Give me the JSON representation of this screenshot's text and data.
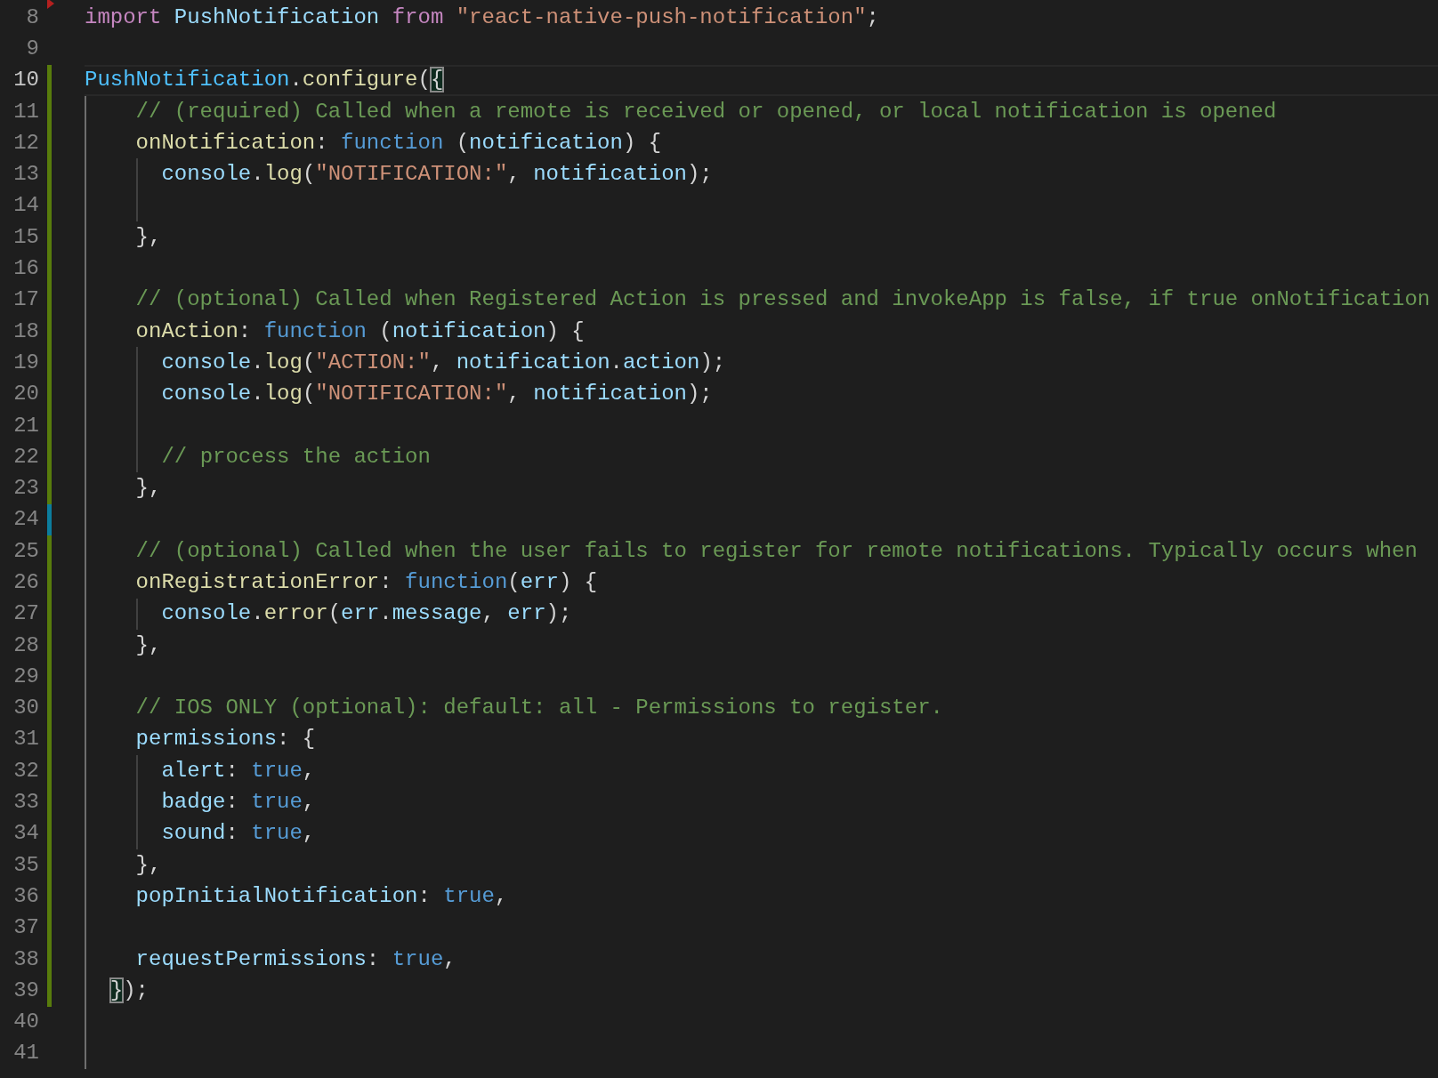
{
  "editor": {
    "lines": [
      {
        "number": "8",
        "kind": "deleted",
        "tokens": [
          {
            "kind": "keyword",
            "text": "import "
          },
          {
            "kind": "variable",
            "text": "PushNotification "
          },
          {
            "kind": "keyword",
            "text": "from "
          },
          {
            "kind": "string",
            "text": "\"react-native-push-notification\""
          },
          {
            "kind": "plain",
            "text": ";"
          }
        ]
      },
      {
        "number": "9",
        "kind": "unchanged"
      },
      {
        "number": "10",
        "kind": "added",
        "current": true,
        "tokens": [
          {
            "kind": "constant",
            "text": "PushNotification"
          },
          {
            "kind": "plain",
            "text": "."
          },
          {
            "kind": "function",
            "text": "configure"
          },
          {
            "kind": "plain",
            "text": "("
          },
          {
            "kind": "plain",
            "text": "{",
            "match": true
          }
        ]
      },
      {
        "number": "11",
        "kind": "added",
        "tokens": [
          {
            "kind": "comment",
            "text": "    // (required) Called when a remote is received or opened, or local notification is opened"
          }
        ]
      },
      {
        "number": "12",
        "kind": "added",
        "tokens": [
          {
            "kind": "function",
            "text": "    onNotification"
          },
          {
            "kind": "plain",
            "text": ": "
          },
          {
            "kind": "storage",
            "text": "function"
          },
          {
            "kind": "plain",
            "text": " ("
          },
          {
            "kind": "variable",
            "text": "notification"
          },
          {
            "kind": "plain",
            "text": ") {"
          }
        ]
      },
      {
        "number": "13",
        "kind": "added",
        "tokens": [
          {
            "kind": "variable",
            "text": "      console"
          },
          {
            "kind": "plain",
            "text": "."
          },
          {
            "kind": "function",
            "text": "log"
          },
          {
            "kind": "plain",
            "text": "("
          },
          {
            "kind": "string",
            "text": "\"NOTIFICATION:\""
          },
          {
            "kind": "plain",
            "text": ", "
          },
          {
            "kind": "variable",
            "text": "notification"
          },
          {
            "kind": "plain",
            "text": ");"
          }
        ]
      },
      {
        "number": "14",
        "kind": "added"
      },
      {
        "number": "15",
        "kind": "added",
        "tokens": [
          {
            "kind": "plain",
            "text": "    },"
          }
        ]
      },
      {
        "number": "16",
        "kind": "added"
      },
      {
        "number": "17",
        "kind": "added",
        "tokens": [
          {
            "kind": "comment",
            "text": "    // (optional) Called when Registered Action is pressed and invokeApp is false, if true onNotification"
          }
        ]
      },
      {
        "number": "18",
        "kind": "added",
        "tokens": [
          {
            "kind": "function",
            "text": "    onAction"
          },
          {
            "kind": "plain",
            "text": ": "
          },
          {
            "kind": "storage",
            "text": "function"
          },
          {
            "kind": "plain",
            "text": " ("
          },
          {
            "kind": "variable",
            "text": "notification"
          },
          {
            "kind": "plain",
            "text": ") {"
          }
        ]
      },
      {
        "number": "19",
        "kind": "added",
        "tokens": [
          {
            "kind": "variable",
            "text": "      console"
          },
          {
            "kind": "plain",
            "text": "."
          },
          {
            "kind": "function",
            "text": "log"
          },
          {
            "kind": "plain",
            "text": "("
          },
          {
            "kind": "string",
            "text": "\"ACTION:\""
          },
          {
            "kind": "plain",
            "text": ", "
          },
          {
            "kind": "variable",
            "text": "notification"
          },
          {
            "kind": "plain",
            "text": "."
          },
          {
            "kind": "variable",
            "text": "action"
          },
          {
            "kind": "plain",
            "text": ");"
          }
        ]
      },
      {
        "number": "20",
        "kind": "added",
        "tokens": [
          {
            "kind": "variable",
            "text": "      console"
          },
          {
            "kind": "plain",
            "text": "."
          },
          {
            "kind": "function",
            "text": "log"
          },
          {
            "kind": "plain",
            "text": "("
          },
          {
            "kind": "string",
            "text": "\"NOTIFICATION:\""
          },
          {
            "kind": "plain",
            "text": ", "
          },
          {
            "kind": "variable",
            "text": "notification"
          },
          {
            "kind": "plain",
            "text": ");"
          }
        ]
      },
      {
        "number": "21",
        "kind": "added"
      },
      {
        "number": "22",
        "kind": "added",
        "tokens": [
          {
            "kind": "comment",
            "text": "      // process the action"
          }
        ]
      },
      {
        "number": "23",
        "kind": "added",
        "tokens": [
          {
            "kind": "plain",
            "text": "    },"
          }
        ]
      },
      {
        "number": "24",
        "kind": "modified"
      },
      {
        "number": "25",
        "kind": "added",
        "tokens": [
          {
            "kind": "comment",
            "text": "    // (optional) Called when the user fails to register for remote notifications. Typically occurs when"
          }
        ]
      },
      {
        "number": "26",
        "kind": "added",
        "tokens": [
          {
            "kind": "function",
            "text": "    onRegistrationError"
          },
          {
            "kind": "plain",
            "text": ": "
          },
          {
            "kind": "storage",
            "text": "function"
          },
          {
            "kind": "plain",
            "text": "("
          },
          {
            "kind": "variable",
            "text": "err"
          },
          {
            "kind": "plain",
            "text": ") {"
          }
        ]
      },
      {
        "number": "27",
        "kind": "added",
        "tokens": [
          {
            "kind": "variable",
            "text": "      console"
          },
          {
            "kind": "plain",
            "text": "."
          },
          {
            "kind": "function",
            "text": "error"
          },
          {
            "kind": "plain",
            "text": "("
          },
          {
            "kind": "variable",
            "text": "err"
          },
          {
            "kind": "plain",
            "text": "."
          },
          {
            "kind": "variable",
            "text": "message"
          },
          {
            "kind": "plain",
            "text": ", "
          },
          {
            "kind": "variable",
            "text": "err"
          },
          {
            "kind": "plain",
            "text": ");"
          }
        ]
      },
      {
        "number": "28",
        "kind": "added",
        "tokens": [
          {
            "kind": "plain",
            "text": "    },"
          }
        ]
      },
      {
        "number": "29",
        "kind": "added"
      },
      {
        "number": "30",
        "kind": "added",
        "tokens": [
          {
            "kind": "comment",
            "text": "    // IOS ONLY (optional): default: all - Permissions to register."
          }
        ]
      },
      {
        "number": "31",
        "kind": "added",
        "tokens": [
          {
            "kind": "variable",
            "text": "    permissions"
          },
          {
            "kind": "plain",
            "text": ": {"
          }
        ]
      },
      {
        "number": "32",
        "kind": "added",
        "tokens": [
          {
            "kind": "variable",
            "text": "      alert"
          },
          {
            "kind": "plain",
            "text": ": "
          },
          {
            "kind": "storage",
            "text": "true"
          },
          {
            "kind": "plain",
            "text": ","
          }
        ]
      },
      {
        "number": "33",
        "kind": "added",
        "tokens": [
          {
            "kind": "variable",
            "text": "      badge"
          },
          {
            "kind": "plain",
            "text": ": "
          },
          {
            "kind": "storage",
            "text": "true"
          },
          {
            "kind": "plain",
            "text": ","
          }
        ]
      },
      {
        "number": "34",
        "kind": "added",
        "tokens": [
          {
            "kind": "variable",
            "text": "      sound"
          },
          {
            "kind": "plain",
            "text": ": "
          },
          {
            "kind": "storage",
            "text": "true"
          },
          {
            "kind": "plain",
            "text": ","
          }
        ]
      },
      {
        "number": "35",
        "kind": "added",
        "tokens": [
          {
            "kind": "plain",
            "text": "    },"
          }
        ]
      },
      {
        "number": "36",
        "kind": "added",
        "tokens": [
          {
            "kind": "variable",
            "text": "    popInitialNotification"
          },
          {
            "kind": "plain",
            "text": ": "
          },
          {
            "kind": "storage",
            "text": "true"
          },
          {
            "kind": "plain",
            "text": ","
          }
        ]
      },
      {
        "number": "37",
        "kind": "added"
      },
      {
        "number": "38",
        "kind": "added",
        "tokens": [
          {
            "kind": "variable",
            "text": "    requestPermissions"
          },
          {
            "kind": "plain",
            "text": ": "
          },
          {
            "kind": "storage",
            "text": "true"
          },
          {
            "kind": "plain",
            "text": ","
          }
        ]
      },
      {
        "number": "39",
        "kind": "added",
        "tokens": [
          {
            "kind": "plain",
            "text": "  }",
            "match": true
          },
          {
            "kind": "plain",
            "text": ");"
          }
        ]
      },
      {
        "number": "40",
        "kind": "unchanged"
      },
      {
        "number": "41",
        "kind": "unchanged"
      }
    ]
  }
}
